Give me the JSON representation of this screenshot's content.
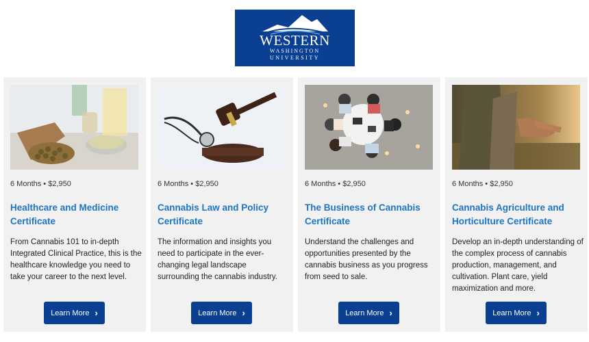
{
  "logo": {
    "line1": "WESTERN",
    "line2": "WASHINGTON",
    "line3": "UNIVERSITY",
    "alt": "Western Washington University"
  },
  "cards": [
    {
      "meta": "6 Months • $2,950",
      "title": "Healthcare and Medicine Certificate",
      "desc": "From Cannabis 101 to in-depth Integrated Clinical Practice, this is the healthcare knowledge you need to take your career to the next level.",
      "button": "Learn More",
      "image_icon": "cannabis-oil-seeds-image"
    },
    {
      "meta": "6 Months • $2,950",
      "title": "Cannabis Law and Policy Certificate",
      "desc": "The information and insights you need to participate in the ever-changing legal landscape surrounding the cannabis industry.",
      "button": "Learn More",
      "image_icon": "gavel-stethoscope-image"
    },
    {
      "meta": "6 Months • $2,950",
      "title": "The Business of Cannabis Certificate",
      "desc": "Understand the challenges and opportunities presented by the cannabis business as you progress from seed to sale.",
      "button": "Learn More",
      "image_icon": "business-meeting-image"
    },
    {
      "meta": "6 Months • $2,950",
      "title": "Cannabis Agriculture and Horticulture Certificate",
      "desc": "Develop an in-depth understanding of the complex process of cannabis production, management, and cultivation. Plant care, yield maximization and more.",
      "button": "Learn More",
      "image_icon": "farmer-hand-field-image"
    }
  ],
  "colors": {
    "brand_blue": "#0a3f92",
    "title_blue": "#1f75c4",
    "card_bg": "#f1f1f1"
  }
}
